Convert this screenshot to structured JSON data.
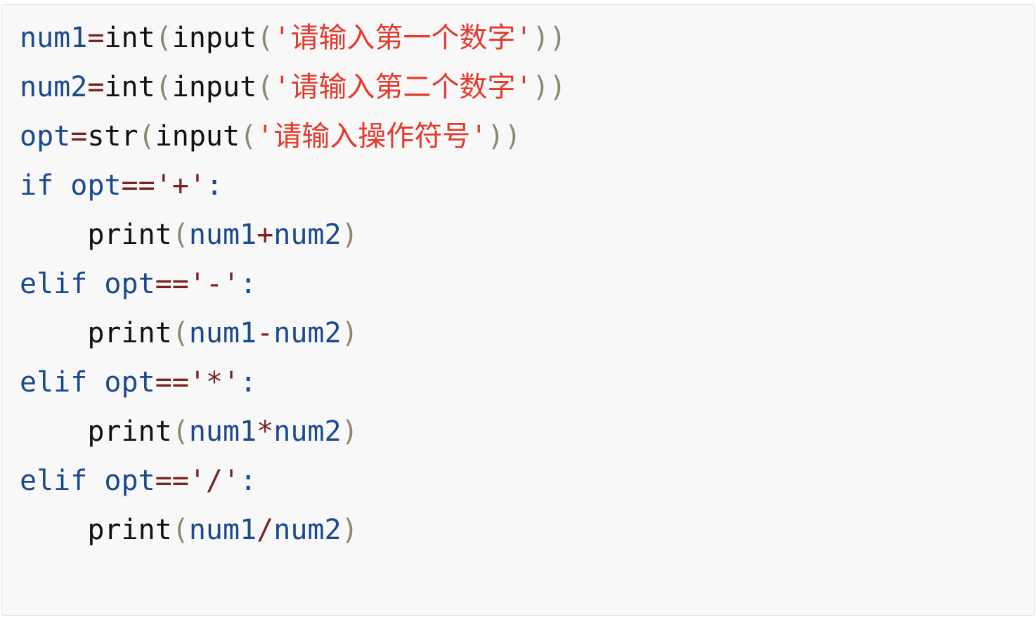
{
  "colors": {
    "background": "#f8f8f8",
    "identifier": "#1b4a8c",
    "operator": "#7a2222",
    "builtin": "#111111",
    "paren": "#8a8a6a",
    "string": "#e33a2c",
    "keyword": "#1b4a8c"
  },
  "code": {
    "language": "python",
    "lines": [
      [
        {
          "t": "num1",
          "k": "ident"
        },
        {
          "t": "=",
          "k": "op"
        },
        {
          "t": "int",
          "k": "builtin"
        },
        {
          "t": "(",
          "k": "paren"
        },
        {
          "t": "input",
          "k": "builtin"
        },
        {
          "t": "(",
          "k": "paren"
        },
        {
          "t": "'请输入第一个数字'",
          "k": "string"
        },
        {
          "t": "))",
          "k": "paren"
        }
      ],
      [
        {
          "t": "num2",
          "k": "ident"
        },
        {
          "t": "=",
          "k": "op"
        },
        {
          "t": "int",
          "k": "builtin"
        },
        {
          "t": "(",
          "k": "paren"
        },
        {
          "t": "input",
          "k": "builtin"
        },
        {
          "t": "(",
          "k": "paren"
        },
        {
          "t": "'请输入第二个数字'",
          "k": "string"
        },
        {
          "t": "))",
          "k": "paren"
        }
      ],
      [
        {
          "t": "opt",
          "k": "ident"
        },
        {
          "t": "=",
          "k": "op"
        },
        {
          "t": "str",
          "k": "builtin"
        },
        {
          "t": "(",
          "k": "paren"
        },
        {
          "t": "input",
          "k": "builtin"
        },
        {
          "t": "(",
          "k": "paren"
        },
        {
          "t": "'请输入操作符号'",
          "k": "string"
        },
        {
          "t": "))",
          "k": "paren"
        }
      ],
      [
        {
          "t": "if",
          "k": "keyword"
        },
        {
          "t": " ",
          "k": "text"
        },
        {
          "t": "opt",
          "k": "ident"
        },
        {
          "t": "==",
          "k": "op"
        },
        {
          "t": "'+'",
          "k": "op"
        },
        {
          "t": ":",
          "k": "ident"
        }
      ],
      [
        {
          "t": "    ",
          "k": "text"
        },
        {
          "t": "print",
          "k": "builtin"
        },
        {
          "t": "(",
          "k": "paren"
        },
        {
          "t": "num1",
          "k": "ident"
        },
        {
          "t": "+",
          "k": "op"
        },
        {
          "t": "num2",
          "k": "ident"
        },
        {
          "t": ")",
          "k": "paren"
        }
      ],
      [
        {
          "t": "elif",
          "k": "keyword"
        },
        {
          "t": " ",
          "k": "text"
        },
        {
          "t": "opt",
          "k": "ident"
        },
        {
          "t": "==",
          "k": "op"
        },
        {
          "t": "'-'",
          "k": "op"
        },
        {
          "t": ":",
          "k": "ident"
        }
      ],
      [
        {
          "t": "    ",
          "k": "text"
        },
        {
          "t": "print",
          "k": "builtin"
        },
        {
          "t": "(",
          "k": "paren"
        },
        {
          "t": "num1",
          "k": "ident"
        },
        {
          "t": "-",
          "k": "op"
        },
        {
          "t": "num2",
          "k": "ident"
        },
        {
          "t": ")",
          "k": "paren"
        }
      ],
      [
        {
          "t": "elif",
          "k": "keyword"
        },
        {
          "t": " ",
          "k": "text"
        },
        {
          "t": "opt",
          "k": "ident"
        },
        {
          "t": "==",
          "k": "op"
        },
        {
          "t": "'*'",
          "k": "op"
        },
        {
          "t": ":",
          "k": "ident"
        }
      ],
      [
        {
          "t": "    ",
          "k": "text"
        },
        {
          "t": "print",
          "k": "builtin"
        },
        {
          "t": "(",
          "k": "paren"
        },
        {
          "t": "num1",
          "k": "ident"
        },
        {
          "t": "*",
          "k": "op"
        },
        {
          "t": "num2",
          "k": "ident"
        },
        {
          "t": ")",
          "k": "paren"
        }
      ],
      [
        {
          "t": "elif",
          "k": "keyword"
        },
        {
          "t": " ",
          "k": "text"
        },
        {
          "t": "opt",
          "k": "ident"
        },
        {
          "t": "==",
          "k": "op"
        },
        {
          "t": "'/'",
          "k": "op"
        },
        {
          "t": ":",
          "k": "ident"
        }
      ],
      [
        {
          "t": "    ",
          "k": "text"
        },
        {
          "t": "print",
          "k": "builtin"
        },
        {
          "t": "(",
          "k": "paren"
        },
        {
          "t": "num1",
          "k": "ident"
        },
        {
          "t": "/",
          "k": "op"
        },
        {
          "t": "num2",
          "k": "ident"
        },
        {
          "t": ")",
          "k": "paren"
        }
      ]
    ]
  }
}
